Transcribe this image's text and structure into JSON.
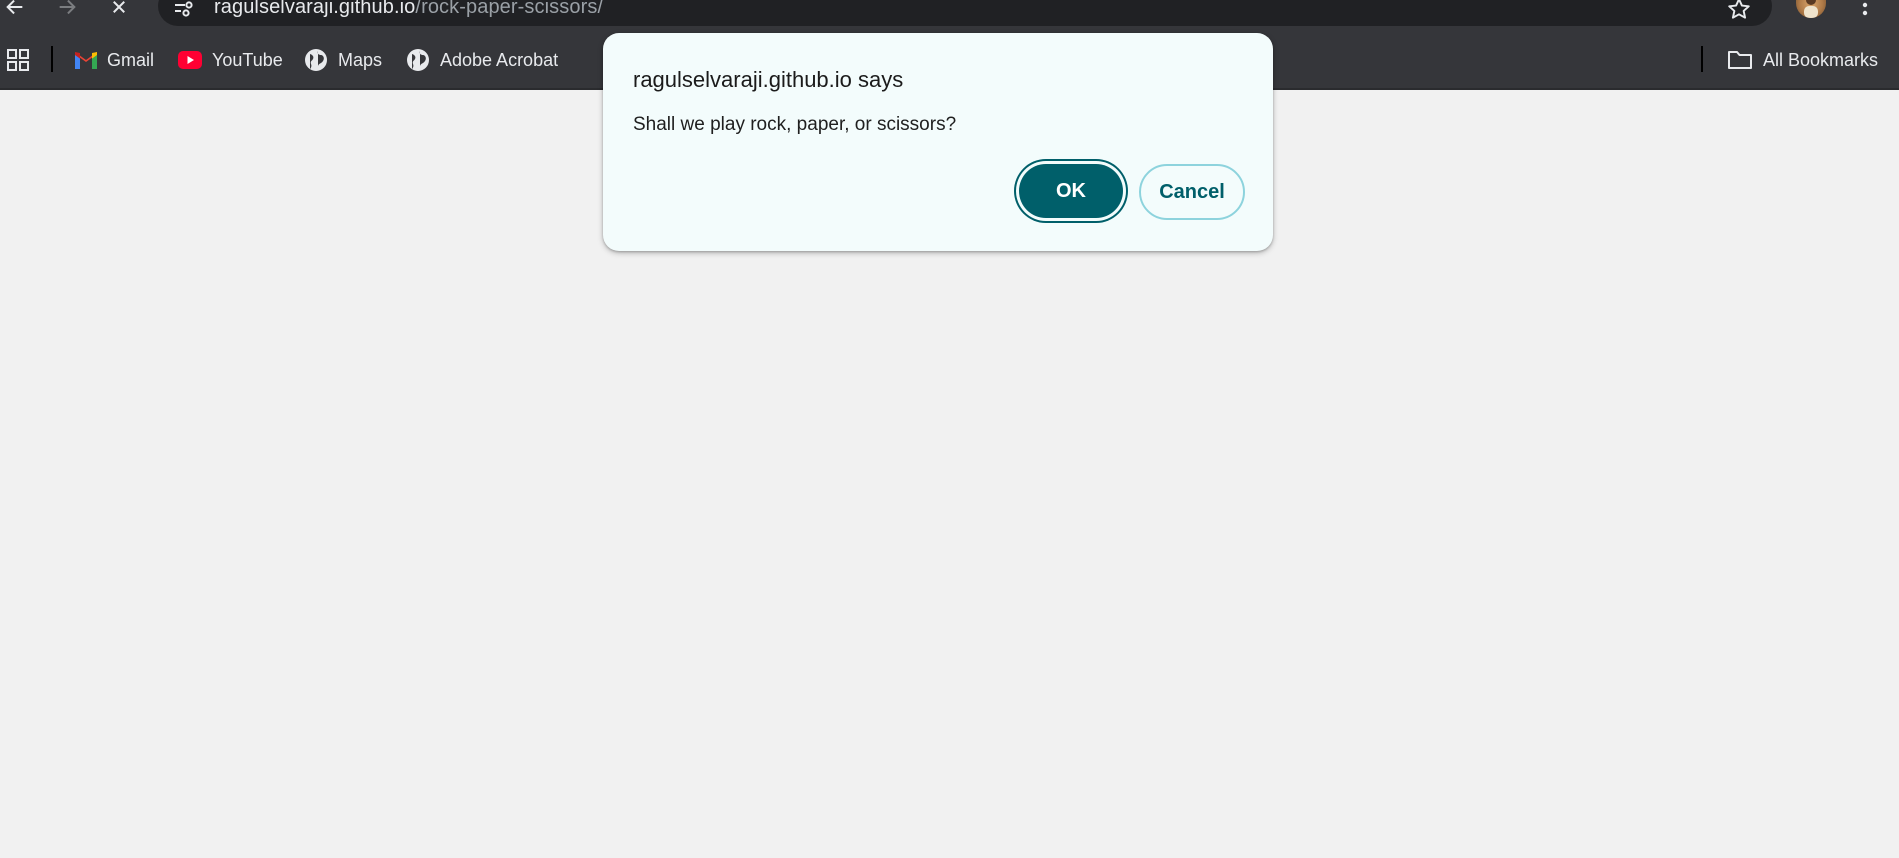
{
  "browser": {
    "url_host": "ragulselvaraji.github.io",
    "url_path": "/rock-paper-scissors/",
    "bookmarks": [
      {
        "label": "Gmail",
        "icon": "gmail-icon"
      },
      {
        "label": "YouTube",
        "icon": "youtube-icon"
      },
      {
        "label": "Maps",
        "icon": "globe-icon"
      },
      {
        "label": "Adobe Acrobat",
        "icon": "globe-icon"
      }
    ],
    "all_bookmarks_label": "All Bookmarks"
  },
  "dialog": {
    "title": "ragulselvaraji.github.io says",
    "message": "Shall we play rock, paper, or scissors?",
    "ok_label": "OK",
    "cancel_label": "Cancel"
  },
  "colors": {
    "chrome_bg": "#35363a",
    "omnibox_bg": "#202124",
    "page_bg": "#f1f1f1",
    "dialog_bg": "#f3fcfc",
    "accent": "#005f6a",
    "cancel_border": "#8dd3dd"
  }
}
